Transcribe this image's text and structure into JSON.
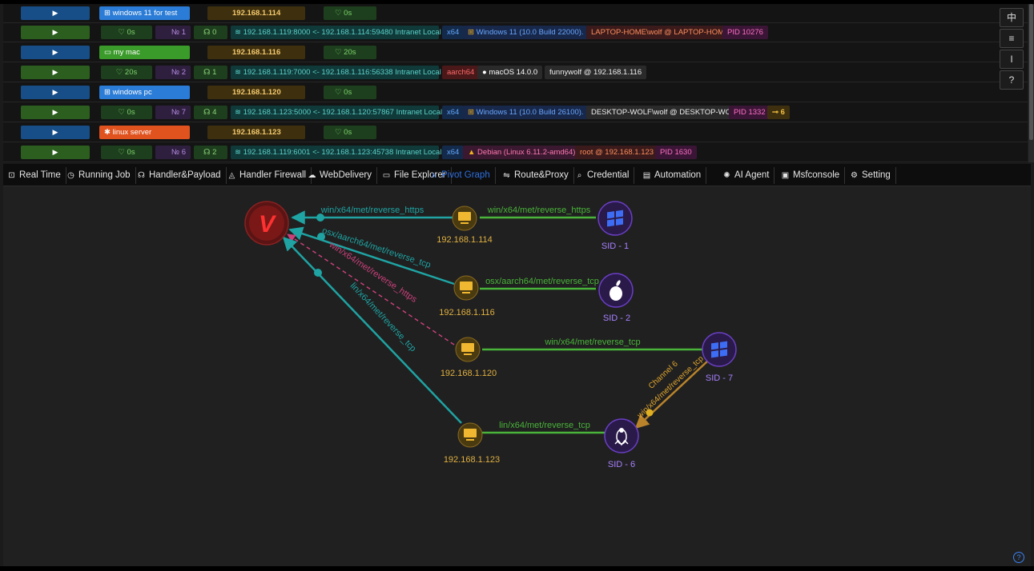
{
  "side_buttons": [
    "中",
    "≡",
    "I",
    "?"
  ],
  "hosts": [
    {
      "hostname": "windows 11 for test",
      "color": "#2b7cd6",
      "ip": "192.168.1.114",
      "duration": "0s",
      "session": {
        "duration": "0s",
        "num": "1",
        "handlers": "0",
        "tunnel": "192.168.1.119:8000 <- 192.168.1.114:59480 Intranet Local",
        "arch": "x64",
        "os": "Windows 11 (10.0 Build 22000).",
        "user": "LAPTOP-HOME\\wolf @ LAPTOP-HOME",
        "pid": "PID 10276"
      }
    },
    {
      "hostname": "my mac",
      "color": "#3a9a2a",
      "ip": "192.168.1.116",
      "duration": "20s",
      "session": {
        "duration": "20s",
        "num": "2",
        "handlers": "1",
        "tunnel": "192.168.1.119:7000 <- 192.168.1.116:56338 Intranet Local",
        "arch": "aarch64",
        "os": "macOS 14.0.0",
        "user": "funnywolf @ 192.168.1.116"
      }
    },
    {
      "hostname": "windows pc",
      "color": "#2b7cd6",
      "ip": "192.168.1.120",
      "duration": "0s",
      "session": {
        "duration": "0s",
        "num": "7",
        "handlers": "4",
        "tunnel": "192.168.1.123:5000 <- 192.168.1.120:57867 Intranet Local",
        "arch": "x64",
        "os": "Windows 11 (10.0 Build 26100).",
        "user": "DESKTOP-WOLF\\wolf @ DESKTOP-WOLF",
        "pid": "PID 1332",
        "channel": "6"
      }
    },
    {
      "hostname": "linux server",
      "color": "#e0521e",
      "ip": "192.168.1.123",
      "duration": "0s",
      "session": {
        "duration": "0s",
        "num": "6",
        "handlers": "2",
        "tunnel": "192.168.1.119:6001 <- 192.168.1.123:45738 Intranet Local",
        "arch": "x64",
        "os": "Debian (Linux 6.11.2-amd64)",
        "user": "root @ 192.168.1.123",
        "pid": "PID 1630"
      }
    }
  ],
  "tabs": [
    "Real Time",
    "Running Job",
    "Handler&Payload",
    "Handler Firewall",
    "WebDelivery",
    "File Explorer",
    "Pivot Graph",
    "Route&Proxy",
    "Credential",
    "Automation",
    "AI Agent",
    "Msfconsole",
    "Setting"
  ],
  "active_tab": "Pivot Graph",
  "graph": {
    "hub_label": "V",
    "hosts": [
      {
        "ip": "192.168.1.114"
      },
      {
        "ip": "192.168.1.116"
      },
      {
        "ip": "192.168.1.120"
      },
      {
        "ip": "192.168.1.123"
      }
    ],
    "sessions": [
      {
        "label": "SID - 1"
      },
      {
        "label": "SID - 2"
      },
      {
        "label": "SID - 7"
      },
      {
        "label": "SID - 6"
      }
    ],
    "edges": [
      {
        "label": "win/x64/met/reverse_https"
      },
      {
        "label": "win/x64/met/reverse_https"
      },
      {
        "label": "osx/aarch64/met/reverse_tcp"
      },
      {
        "label": "osx/aarch64/met/reverse_tcp"
      },
      {
        "label": "win/x64/met/reverse_https"
      },
      {
        "label": "win/x64/met/reverse_tcp"
      },
      {
        "label": "lin/x64/met/reverse_tcp"
      },
      {
        "label": "lin/x64/met/reverse_tcp"
      },
      {
        "label": "Channel 6"
      },
      {
        "label": "win/x64/met/reverse_tcp"
      }
    ],
    "colors": {
      "green": "#49b33a",
      "teal": "#1fa3a3",
      "pink": "#c9407a",
      "orange": "#e0a52e",
      "hub": "#e02424",
      "session": "#6a3fc4"
    }
  }
}
